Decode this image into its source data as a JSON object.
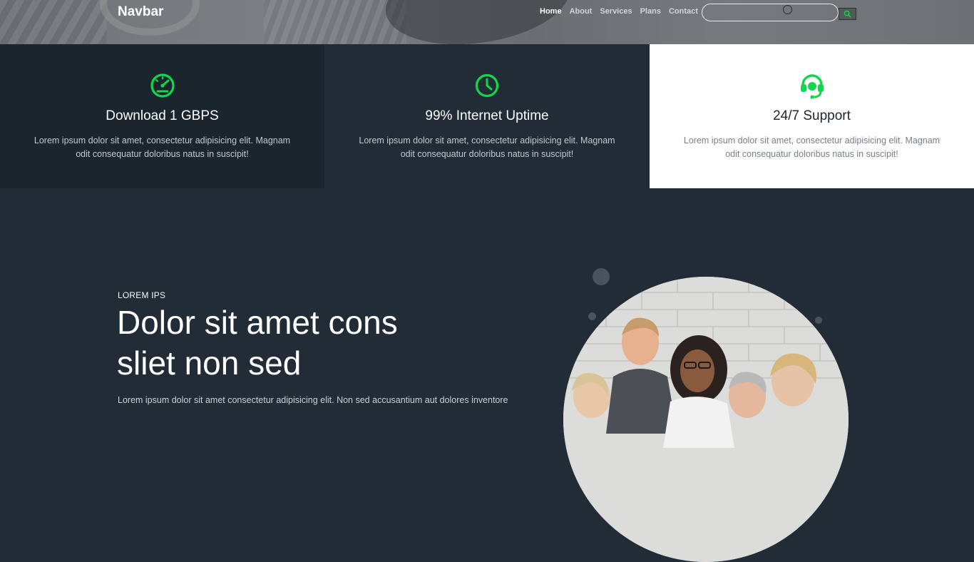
{
  "navbar": {
    "brand": "Navbar",
    "links": [
      {
        "label": "Home",
        "active": true
      },
      {
        "label": "About",
        "active": false
      },
      {
        "label": "Services",
        "active": false
      },
      {
        "label": "Plans",
        "active": false
      },
      {
        "label": "Contact",
        "active": false
      }
    ],
    "search": {
      "value": "",
      "placeholder": "",
      "button_icon": "search-icon"
    }
  },
  "features": [
    {
      "icon": "speedometer-icon",
      "title": "Download 1 GBPS",
      "text": "Lorem ipsum dolor sit amet, consectetur adipisicing elit. Magnam odit consequatur doloribus natus in suscipit!"
    },
    {
      "icon": "clock-icon",
      "title": "99% Internet Uptime",
      "text": "Lorem ipsum dolor sit amet, consectetur adipisicing elit. Magnam odit consequatur doloribus natus in suscipit!"
    },
    {
      "icon": "headset-icon",
      "title": "24/7 Support",
      "text": "Lorem ipsum dolor sit amet, consectetur adipisicing elit. Magnam odit consequatur doloribus natus in suscipit!"
    }
  ],
  "about": {
    "eyebrow": "LOREM IPS",
    "headline_line1": "Dolor sit amet cons",
    "headline_line2": "sliet non sed",
    "body": "Lorem ipsum dolor sit amet consectetur adipisicing elit. Non sed accusantium aut dolores inventore",
    "image": "team-photo"
  },
  "colors": {
    "accent_green": "#10d84a",
    "dark_bg": "#212c36",
    "darker_card": "#1b252e",
    "light_card": "#ffffff"
  }
}
